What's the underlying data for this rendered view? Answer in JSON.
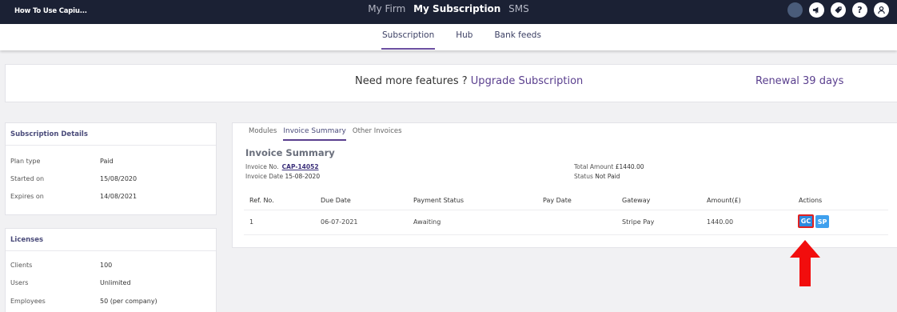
{
  "topbar": {
    "brand": "How To Use Capiu...",
    "nav": [
      {
        "label": "My Firm",
        "active": false
      },
      {
        "label": "My Subscription",
        "active": true
      },
      {
        "label": "SMS",
        "active": false
      }
    ],
    "icons": [
      "avatar-icon",
      "megaphone-icon",
      "tag-icon",
      "help-icon",
      "user-icon"
    ],
    "help_glyph": "?"
  },
  "subnav": {
    "items": [
      "Subscription",
      "Hub",
      "Bank feeds"
    ],
    "active": "Subscription"
  },
  "banner": {
    "prefix": "Need more features ? ",
    "link": "Upgrade Subscription",
    "renewal": "Renewal 39 days"
  },
  "subscription_details": {
    "title": "Subscription Details",
    "rows": [
      {
        "key": "Plan type",
        "value": "Paid"
      },
      {
        "key": "Started on",
        "value": "15/08/2020"
      },
      {
        "key": "Expires on",
        "value": "14/08/2021"
      }
    ]
  },
  "licenses": {
    "title": "Licenses",
    "rows": [
      {
        "key": "Clients",
        "value": "100"
      },
      {
        "key": "Users",
        "value": "Unlimited"
      },
      {
        "key": "Employees",
        "value": "50 (per company)"
      }
    ]
  },
  "invoice": {
    "tabs": [
      "Modules",
      "Invoice Summary",
      "Other Invoices"
    ],
    "active_tab": "Invoice Summary",
    "heading": "Invoice Summary",
    "invoice_no_label": "Invoice No.",
    "invoice_no": "CAP-14052",
    "invoice_date_label": "Invoice Date",
    "invoice_date": "15-08-2020",
    "total_amount_label": "Total Amount",
    "total_amount": "£1440.00",
    "status_label": "Status",
    "status": "Not Paid",
    "columns": [
      "Ref. No.",
      "Due Date",
      "Payment Status",
      "Pay Date",
      "Gateway",
      "Amount(£)",
      "Actions"
    ],
    "rows": [
      {
        "ref": "1",
        "due_date": "06-07-2021",
        "payment_status": "Awaiting",
        "pay_date": "",
        "gateway": "Stripe Pay",
        "amount": "1440.00"
      }
    ],
    "actions": {
      "gc": "GC",
      "sp": "SP"
    }
  },
  "colors": {
    "topbar": "#1b2134",
    "accent": "#5a3f8e",
    "highlight": "#e02020",
    "button": "#2c8ae0"
  }
}
